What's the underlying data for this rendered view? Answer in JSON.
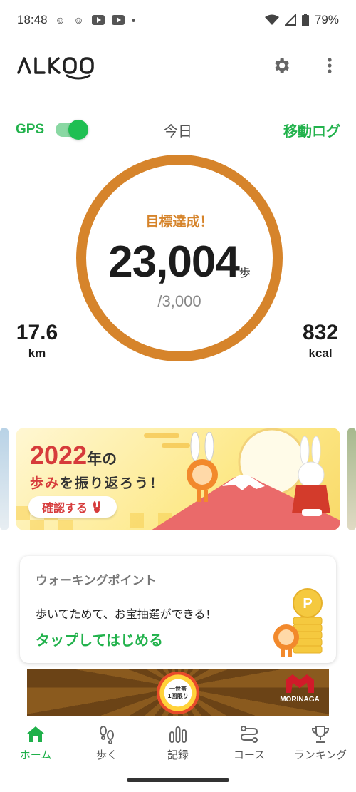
{
  "status_bar": {
    "time": "18:48",
    "battery": "79%"
  },
  "header": {
    "logo": "ALK00",
    "settings_icon": "gear-icon",
    "more_icon": "more-vert-icon"
  },
  "tracker": {
    "gps_label": "GPS",
    "gps_enabled": true,
    "day_label": "今日",
    "move_log_label": "移動ログ",
    "goal_status": "目標達成！",
    "steps": "23,004",
    "steps_unit": "歩",
    "goal": "/3,000",
    "distance_value": "17.6",
    "distance_unit": "km",
    "calories_value": "832",
    "calories_unit": "kcal",
    "ring_color": "#d6842b"
  },
  "banner": {
    "year": "2022",
    "year_suffix": "年の",
    "line2_a": "歩み",
    "line2_b": "を振り返ろう！",
    "button_label": "確認する"
  },
  "walking_point": {
    "title": "ウォーキングポイント",
    "description": "歩いてためて、お宝抽選ができる！",
    "cta": "タップしてはじめる"
  },
  "ad": {
    "badge_line1": "一世帯",
    "badge_line2": "1回限り",
    "brand": "MORINAGA"
  },
  "nav": {
    "items": [
      {
        "label": "ホーム",
        "icon": "home-icon"
      },
      {
        "label": "歩く",
        "icon": "footprints-icon"
      },
      {
        "label": "記録",
        "icon": "bar-chart-icon"
      },
      {
        "label": "コース",
        "icon": "route-icon"
      },
      {
        "label": "ランキング",
        "icon": "trophy-icon"
      }
    ],
    "active_color": "#1fb04a"
  }
}
